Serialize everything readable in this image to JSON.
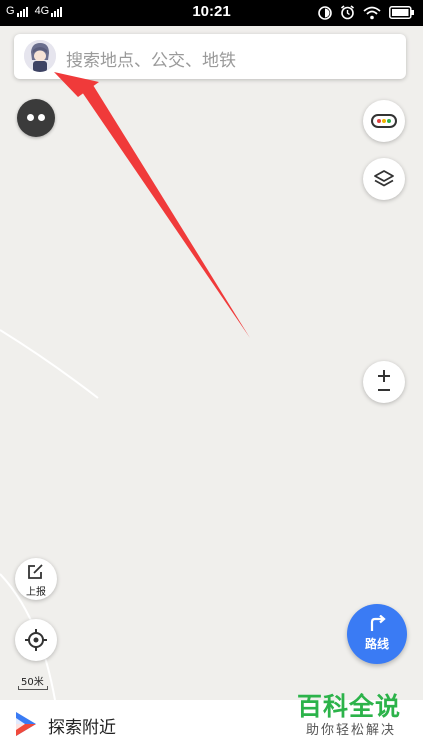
{
  "status_bar": {
    "carrier1": "G",
    "carrier2": "4G",
    "time": "10:21",
    "icons": [
      "do-not-disturb-icon",
      "alarm-icon",
      "wifi-icon",
      "battery-icon"
    ]
  },
  "search": {
    "placeholder": "搜索地点、公交、地铁",
    "avatar_icon": "user-avatar"
  },
  "map_controls": {
    "report_label": "上报",
    "scale_label": "50米",
    "zoom_icons": [
      "plus-icon",
      "minus-icon"
    ],
    "traffic_icon": "traffic-light-icon",
    "layers_icon": "layers-icon",
    "locate_icon": "locate-icon"
  },
  "route_button": {
    "label": "路线",
    "color": "#3a7bf4"
  },
  "bottom_bar": {
    "nearby_label": "探索附近"
  },
  "watermark": {
    "title": "百科全说",
    "subtitle": "助你轻松解决"
  },
  "colors": {
    "map_bg": "#f0efec",
    "annotation_arrow": "#f03a3a",
    "brand_green": "#2cb34a"
  }
}
